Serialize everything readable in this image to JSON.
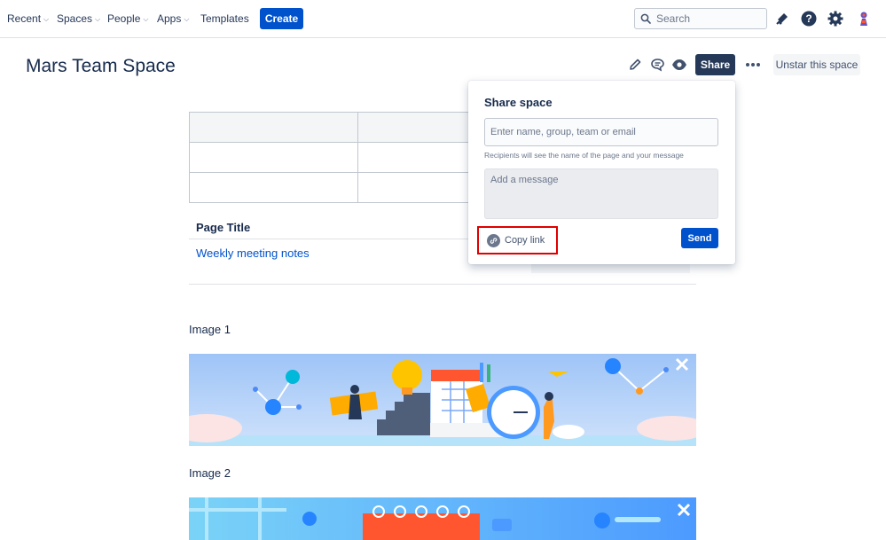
{
  "nav": {
    "items": [
      {
        "label": "Recent",
        "dropdown": true
      },
      {
        "label": "Spaces",
        "dropdown": true
      },
      {
        "label": "People",
        "dropdown": true
      },
      {
        "label": "Apps",
        "dropdown": true
      },
      {
        "label": "Templates",
        "dropdown": false
      }
    ],
    "create_label": "Create",
    "search_placeholder": "Search",
    "icons": [
      "notifications-icon",
      "help-icon",
      "settings-icon",
      "avatar"
    ]
  },
  "page": {
    "title": "Mars Team Space",
    "actions": {
      "icons": [
        "edit-icon",
        "comment-icon",
        "watch-icon"
      ],
      "share_label": "Share",
      "more_icon": "more-icon",
      "unstar_label": "Unstar this space"
    }
  },
  "content": {
    "table_rows": 3,
    "page_title_header": "Page Title",
    "page_link": "Weekly meeting notes",
    "image1_label": "Image 1",
    "image2_label": "Image 2"
  },
  "share_popover": {
    "title": "Share space",
    "recipients_placeholder": "Enter name, group, team or email",
    "hint": "Recipients will see the name of the page and your message",
    "message_placeholder": "Add a message",
    "copy_link_label": "Copy link",
    "send_label": "Send"
  },
  "colors": {
    "primary": "#0052cc",
    "share_button": "#253858",
    "highlight": "#e00000",
    "link": "#0052cc"
  }
}
